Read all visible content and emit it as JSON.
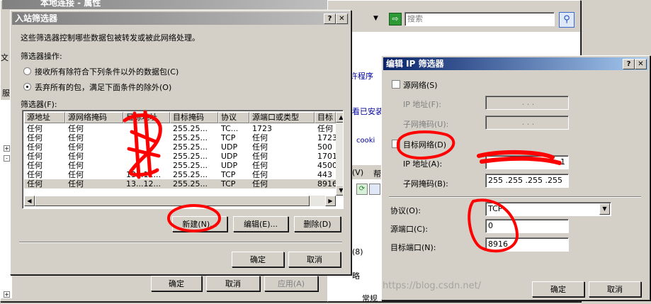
{
  "bg": {
    "title": "本地连接 - 属性",
    "menu_file": "文",
    "service_tab": "服",
    "search_placeholder": "搜索",
    "link_allow": "允许程序",
    "link_installed": "看已安装",
    "cookie_text": "cooki",
    "menu_v": "(V)",
    "menu_help": "帮",
    "text_8": "(8)",
    "text_policy": "略",
    "text_normal": "常规"
  },
  "prop_buttons": {
    "ok": "确定",
    "cancel": "取消",
    "apply": "应用(A)"
  },
  "inbound": {
    "title": "入站筛选器",
    "description": "这些筛选器控制哪些数据包被转发或被此网络处理。",
    "action_label": "筛选器操作:",
    "radio1": "接收所有除符合下列条件以外的数据包(C)",
    "radio2": "丢弃所有的包，满足下面条件的除外(O)",
    "radio_selected": 2,
    "filters_label": "筛选器(F):",
    "columns": [
      "源地址",
      "源网络掩码",
      "目标地址",
      "目标掩码",
      "协议",
      "源端口或类型",
      "目标"
    ],
    "rows": [
      [
        "任何",
        "任何",
        "",
        "255.25...",
        "TC...",
        "1723",
        "任何"
      ],
      [
        "任何",
        "任何",
        "",
        "255.25...",
        "TCP",
        "任何",
        "1723"
      ],
      [
        "任何",
        "任何",
        "",
        "255.25...",
        "UDP",
        "任何",
        "500"
      ],
      [
        "任何",
        "任何",
        "",
        "255.25...",
        "UDP",
        "任何",
        "1701"
      ],
      [
        "任何",
        "任何",
        "",
        "255.25...",
        "UDP",
        "任何",
        "4500"
      ],
      [
        "任何",
        "任何",
        "13...12...",
        "255.25...",
        "TCP",
        "任何",
        "443"
      ],
      [
        "任何",
        "任何",
        "13...12...",
        "255.25...",
        "TCP",
        "任何",
        "8916"
      ]
    ],
    "btn_new": "新建(N)...",
    "btn_edit": "编辑(E)...",
    "btn_delete": "删除(D)",
    "btn_ok": "确定",
    "btn_cancel": "取消"
  },
  "ipfilter": {
    "title": "编辑 IP 筛选器",
    "src_network": "源网络(S)",
    "src_ip_label": "IP 地址(F):",
    "src_mask_label": "子网掩码(U):",
    "src_ip_value": ".  .  .",
    "src_mask_value": ".  .  .",
    "dst_network": "目标网络(D)",
    "dst_ip_label": "IP 地址(A):",
    "dst_ip_value": "1",
    "dst_mask_label": "子网掩码(B):",
    "dst_mask_value": "255 .255 .255 .255",
    "protocol_label": "协议(O):",
    "protocol_value": "TCP",
    "src_port_label": "源端口(C):",
    "src_port_value": "0",
    "dst_port_label": "目标端口(N):",
    "dst_port_value": "8916",
    "btn_ok": "确定",
    "btn_cancel": "取消"
  },
  "watermark": "https://blog.csdn.net/",
  "colors": {
    "title_active": "#0a246a",
    "annotation_red": "#ff0000"
  }
}
